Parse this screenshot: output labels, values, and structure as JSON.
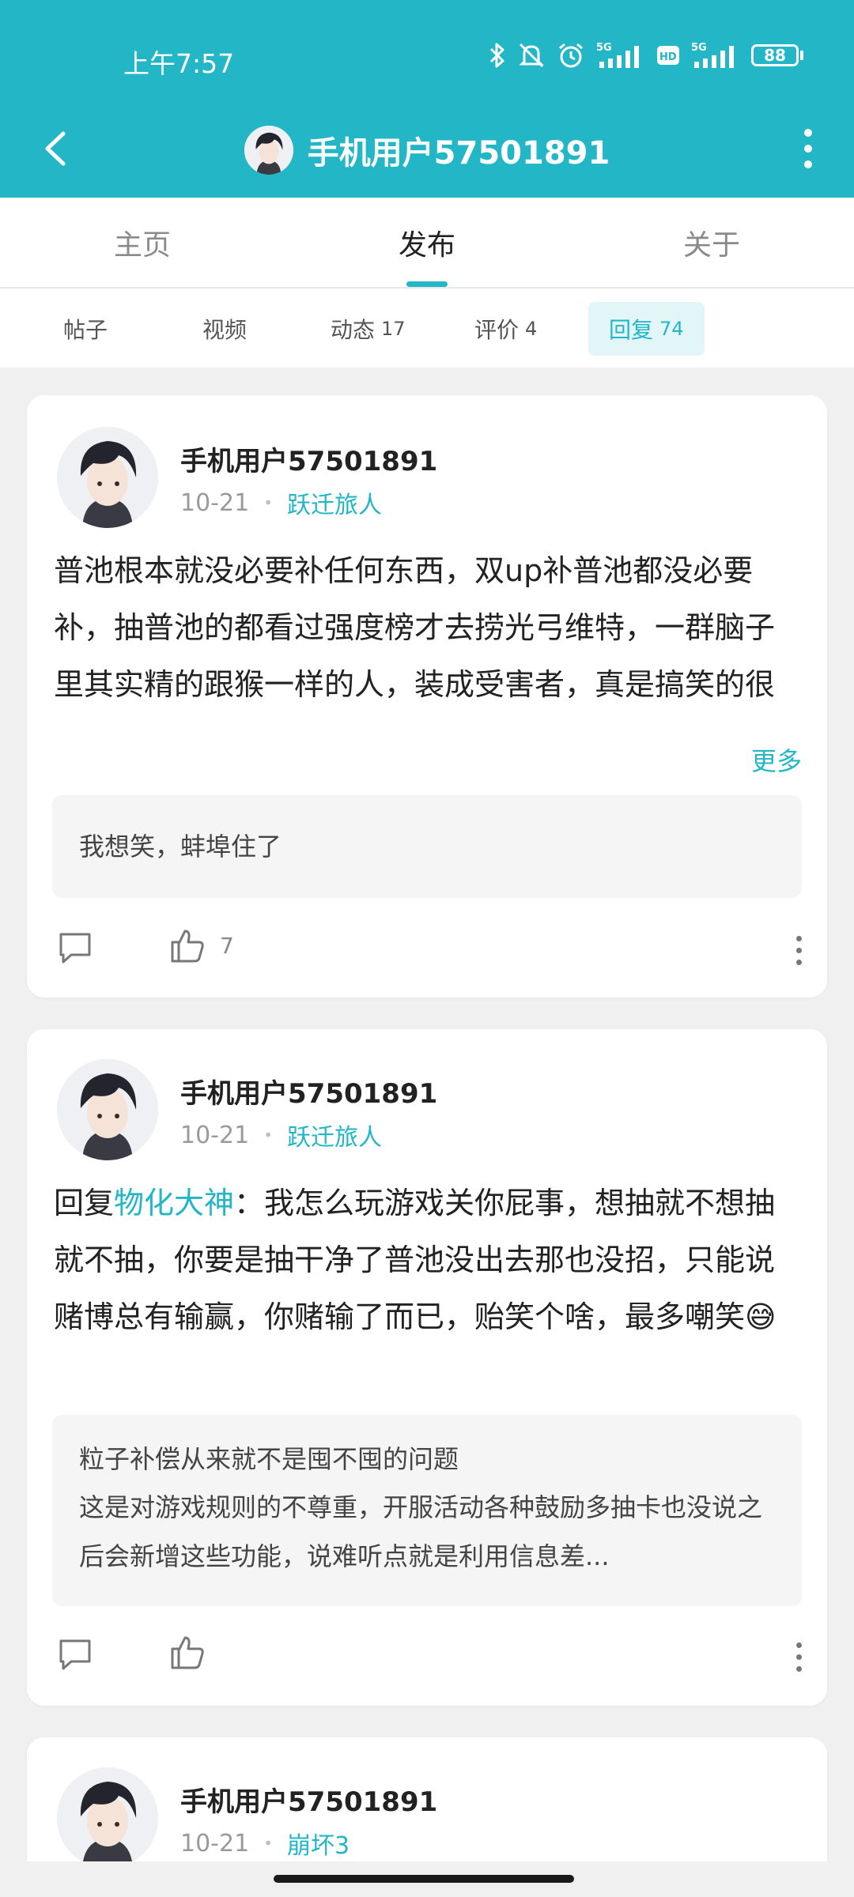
{
  "status_bar": {
    "time": "上午7:57",
    "battery": "88",
    "icons": [
      "bluetooth-icon",
      "mute-icon",
      "alarm-icon",
      "5g-signal-icon",
      "hd-icon",
      "5g-signal-icon",
      "battery-icon"
    ]
  },
  "header": {
    "title": "手机用户57501891",
    "back_icon": "chevron-left-icon",
    "more_icon": "more-vertical-icon"
  },
  "main_tabs": [
    {
      "label": "主页",
      "active": false
    },
    {
      "label": "发布",
      "active": true
    },
    {
      "label": "关于",
      "active": false
    }
  ],
  "sub_tabs": [
    {
      "label": "帖子",
      "count": ""
    },
    {
      "label": "视频",
      "count": ""
    },
    {
      "label": "动态",
      "count": "17"
    },
    {
      "label": "评价",
      "count": "4"
    },
    {
      "label": "回复",
      "count": "74",
      "active": true
    }
  ],
  "posts": [
    {
      "author": "手机用户57501891",
      "date": "10-21",
      "game": "跃迁旅人",
      "content": "普池根本就没必要补任何东西，双up补普池都没必要补，抽普池的都看过强度榜才去捞光弓维特，一群脑子里其实精的跟猴一样的人，装成受害者，真是搞笑的很",
      "more_label": "更多",
      "quote": "我想笑，蚌埠住了",
      "likes": "7"
    },
    {
      "author": "手机用户57501891",
      "date": "10-21",
      "game": "跃迁旅人",
      "reply_prefix": "回复",
      "mention": "物化大神",
      "content": "：我怎么玩游戏关你屁事，想抽就不想抽就不抽，你要是抽干净了普池没出去那也没招，只能说赌博总有输赢，你赌输了而已，贻笑个啥，最多嘲笑",
      "emoji": "😅",
      "quote_line1": "粒子补偿从来就不是囤不囤的问题",
      "quote_line2": "这是对游戏规则的不尊重，开服活动各种鼓励多抽卡也没说之后会新增这些功能，说难听点就是利用信息差...",
      "likes": ""
    },
    {
      "author": "手机用户57501891",
      "date": "10-21",
      "game": "崩坏3"
    }
  ]
}
